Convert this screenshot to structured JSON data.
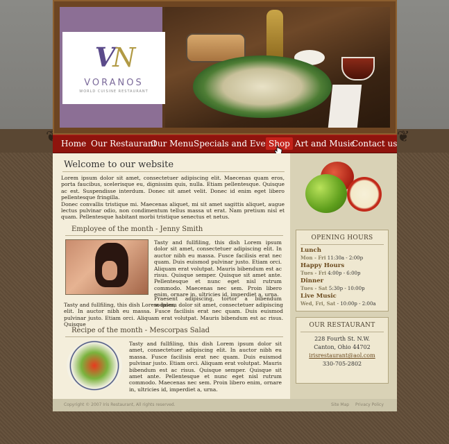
{
  "brand": {
    "initials_first": "V",
    "initials_second": "N",
    "name": "VORANOS",
    "tagline": "WORLD CUISINE RESTAURANT"
  },
  "nav": [
    {
      "label": "Home"
    },
    {
      "label": "Our Restaurant"
    },
    {
      "label": "Our Menu"
    },
    {
      "label": "Specials and Events"
    },
    {
      "label": "Shop"
    },
    {
      "label": "Art and Music"
    },
    {
      "label": "Contact us"
    }
  ],
  "welcome": {
    "title": "Welcome to our website",
    "para1": "Lorem ipsum dolor sit amet, consectetuer adipiscing elit. Maecenas quam eros, porta faucibus, scelerisque eu, dignissim quis, nulla. Etiam pellentesque. Quisque ac est. Suspendisse interdum. Donec sit amet velit. Donec id enim eget libero pellentesque fringilla.",
    "para2": "Donec convallis tristique mi. Maecenas aliquet, mi sit amet sagittis aliquet, augue lectus pulvinar odio, non condimentum tellus massa ut erat. Nam pretium nisl et quam. Pellentesque habitant morbi tristique senectus et netus."
  },
  "employee": {
    "title": "Employee of the month - Jenny Smith",
    "text1": "Tasty and fullfiling, this dish Lorem ipsum dolor sit amet, consectetuer adipiscing elit. In auctor nibh eu massa. Fusce facilisis erat nec quam. Duis euismod pulvinar justo. Etiam orci. Aliquam erat volutpat. Mauris bibendum est ac risus. Quisque semper. Quisque sit amet ante. Pellentesque et nunc eget nisl rutrum commodo. Maecenas nec sem. Proin libero enim, ornare in, ultricies id, imperdiet a, urna.",
    "text2": "Praesent adipiscing, tortor a bibendum sodales,",
    "text3": "Tasty and fullfiling, this dish Lorem ipsum dolor sit amet, consectetuer adipiscing elit. In auctor nibh eu massa. Fusce facilisis erat nec quam. Duis euismod pulvinar justo. Etiam orci. Aliquam erat volutpat. Mauris bibendum est ac risus. Quisque"
  },
  "recipe": {
    "title": "Recipe of the month - Mescorpas Salad",
    "text": "Tasty and fullfiling, this dish Lorem ipsum dolor sit amet, consectetuer adipiscing elit. In auctor nibh eu massa. Fusce facilisis erat nec quam. Duis euismod pulvinar justo. Etiam orci. Aliquam erat volutpat. Mauris bibendum est ac risus. Quisque semper. Quisque sit amet ante. Pellentesque et nunc eget nisl rutrum commodo. Maecenas nec sem. Proin libero enim, ornare in, ultricies id, imperdiet a, urna."
  },
  "hours": {
    "title": "OPENING HOURS",
    "items": [
      {
        "label": "Lunch",
        "days": "Mon - Fri",
        "time": "11:30a - 2:00p"
      },
      {
        "label": "Happy Hours",
        "days": "Tues - Fri",
        "time": "4:00p - 6:00p"
      },
      {
        "label": "Dinner",
        "days": "Tues - Sat",
        "time": "5:30p - 10:00p"
      },
      {
        "label": "Live Music",
        "days": "Wed, Fri, Sat",
        "time": "- 10:00p - 2:00a"
      }
    ]
  },
  "restaurant": {
    "title": "OUR RESTAURANT",
    "address1": "228 Fourth St. N.W.",
    "address2": "Canton, Ohio 44702",
    "email": "irisrestaurant@aol.com",
    "phone": "330-705-2802"
  },
  "footer": {
    "copyright": "Copyright © 2007 Iris Restaurant, All rights reserved.",
    "sitemap": "Site Map",
    "privacy": "Privacy Policy"
  },
  "colors": {
    "nav_bg": "#8f140d",
    "nav_active": "#c4221a",
    "content_bg": "#f4eedb",
    "sidebar_bg": "#d9d2b6",
    "logo_panel": "#8c6f95"
  }
}
